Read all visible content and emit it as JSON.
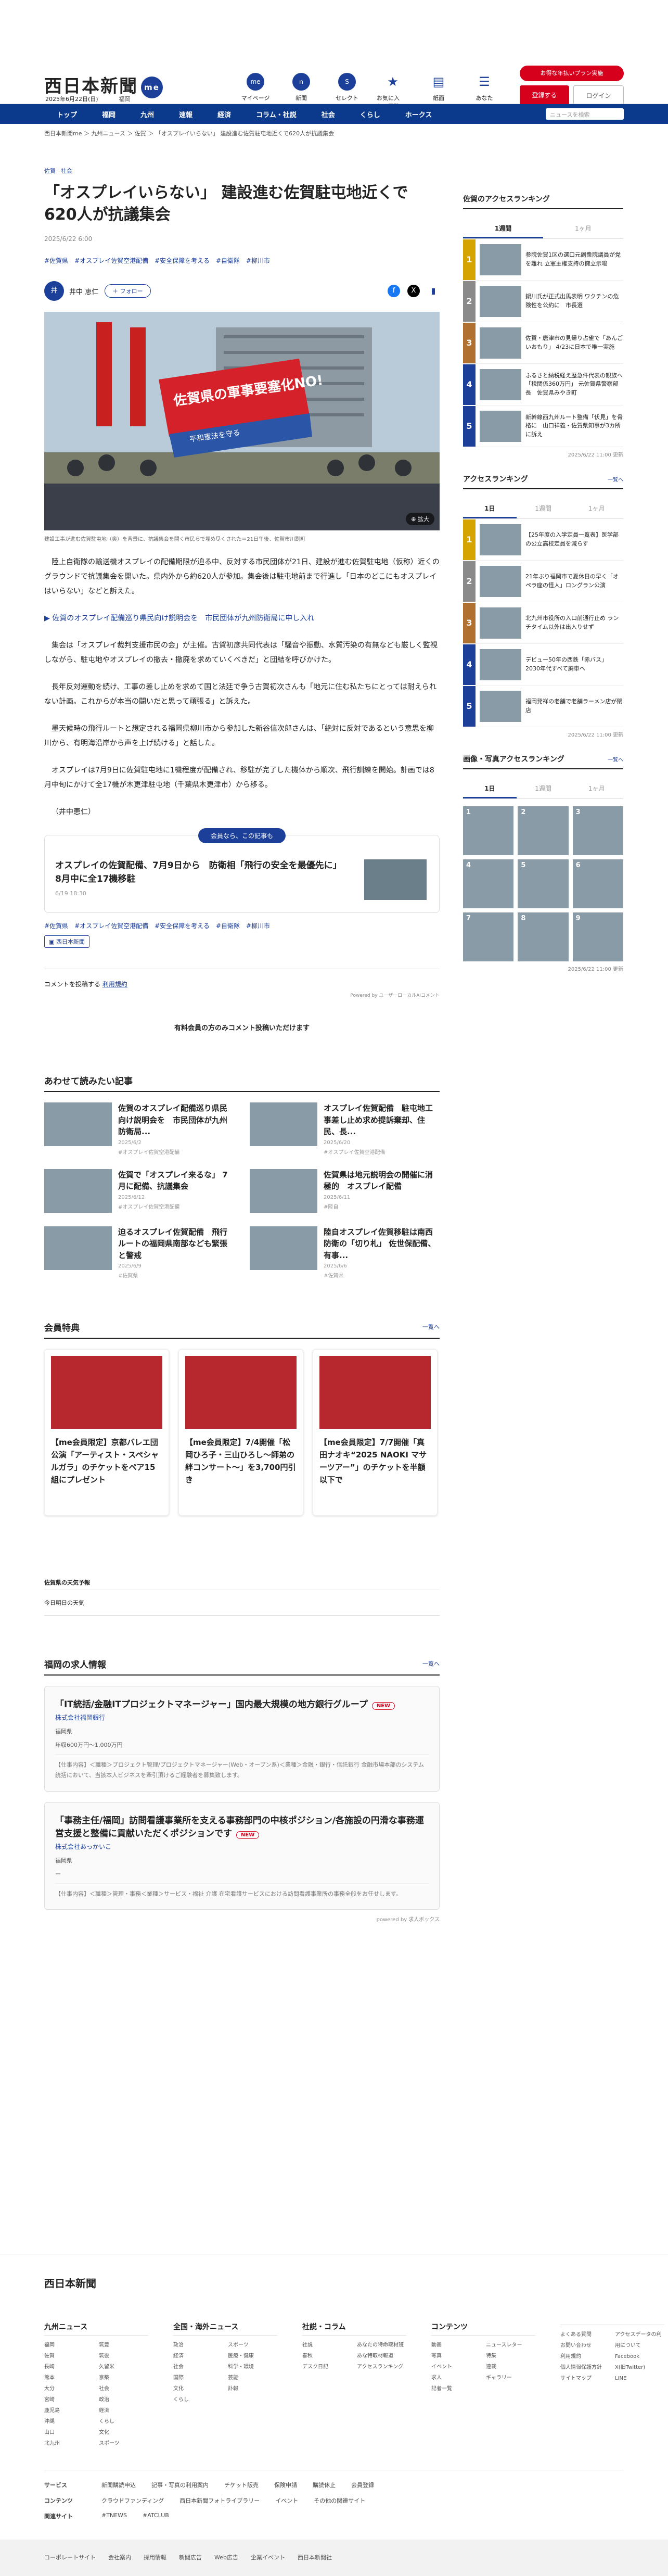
{
  "header": {
    "logo": "西日本新聞",
    "logo_badge": "me",
    "date": "2025年6月22日(日)",
    "region": "福岡",
    "icons": [
      {
        "label": "マイページ",
        "glyph": "me"
      },
      {
        "label": "新聞",
        "glyph": "ｎ"
      },
      {
        "label": "セレクト",
        "glyph": "S"
      },
      {
        "label": "お気に入り・閲覧",
        "glyph": "★"
      },
      {
        "label": "紙面",
        "glyph": "▤"
      },
      {
        "label": "あなた",
        "glyph": "☰"
      }
    ],
    "promo": "お得な年払いプラン実施",
    "register": "登録する",
    "login": "ログイン"
  },
  "nav": {
    "items": [
      "トップ",
      "福岡",
      "九州",
      "速報",
      "経済",
      "コラム・社説",
      "社会",
      "くらし",
      "ホークス"
    ],
    "search_placeholder": "ニュースを検索"
  },
  "breadcrumb": "西日本新聞me ＞ 九州ニュース ＞ 佐賀 ＞ 「オスプレイいらない」 建設進む佐賀駐屯地近くで620人が抗議集会",
  "article": {
    "categories": [
      "佐賀",
      "社会"
    ],
    "title": "「オスプレイいらない」 建設進む佐賀駐屯地近くで620人が抗議集会",
    "date": "2025/6/22 6:00",
    "keywords": [
      "#佐賀県",
      "#オスプレイ佐賀空港配備",
      "#安全保障を考える",
      "#自衛隊",
      "#柳川市"
    ],
    "author": "井中 恵仁",
    "author_initial": "井",
    "follow": "＋ フォロー",
    "photo_banner": "佐賀県の軍事要塞化NO!",
    "photo_banner_sub": "平和憲法を守る",
    "photo_zoom": "拡大",
    "caption": "建設工事が進む佐賀駐屯地（奥）を背景に、抗議集会を開く市民らで埋め尽くされた＝21日午後、佐賀市川副町",
    "paragraphs": [
      "陸上自衛隊の輸送機オスプレイの配備期限が迫る中、反対する市民団体が21日、建設が進む佐賀駐屯地（仮称）近くのグラウンドで抗議集会を開いた。県内外から約620人が参加。集会後は駐屯地前まで行進し「日本のどこにもオスプレイはいらない」などと訴えた。",
      "集会は「オスプレイ裁判支援市民の会」が主催。古賀初彦共同代表は「騒音や振動、水質汚染の有無なども厳しく監視しながら、駐屯地やオスプレイの撤去・撤廃を求めていくべきだ」と団結を呼びかけた。",
      "長年反対運動を続け、工事の差し止めを求めて国と法廷で争う古賀初次さんも「地元に住む私たちにとっては耐えられない計画。これからが本当の闘いだと思って頑張る」と訴えた。",
      "墨天候時の飛行ルートと想定される福岡県柳川市から参加した新谷信次郎さんは、「絶対に反対であるという意思を柳川から、有明海沿岸から声を上げ続ける」と話した。",
      "オスプレイは7月9日に佐賀駐屯地に1機程度が配備され、移駐が完了した機体から順次、飛行訓練を開始。計画では8月中旬にかけて全17機が木更津駐屯地（千葉県木更津市）から移る。"
    ],
    "link": "▶ 佐賀のオスプレイ配備巡り県民向け説明会を　市民団体が九州防衛局に申し入れ",
    "byline": "（井中恵仁）",
    "card": {
      "pill": "会員なら、この記事も",
      "title": "オスプレイの佐賀配備、7月9日から　防衛相「飛行の安全を最優先に」8月中に全17機移駐",
      "date": "6/19 18:30"
    },
    "feedback": "▣ 西日本新聞"
  },
  "comments": {
    "post": "コメントを投稿する",
    "rule": "利用規約",
    "powered": "Powered by ユーザーローカルAIコメント",
    "notice": "有料会員の方のみコメント投稿いただけます"
  },
  "related": {
    "title": "あわせて読みたい記事",
    "items": [
      {
        "title": "佐賀のオスプレイ配備巡り県民向け説明会を　市民団体が九州防衛局...",
        "date": "2025/6/2",
        "tag": "#オスプレイ佐賀空港配備"
      },
      {
        "title": "オスプレイ佐賀配備　駐屯地工事差し止め求め提訴棄却、住民、長...",
        "date": "2025/6/20",
        "tag": "#オスプレイ佐賀空港配備"
      },
      {
        "title": "佐賀で「オスプレイ来るな」 7月に配備、抗議集会",
        "date": "2025/6/12",
        "tag": "#オスプレイ佐賀空港配備"
      },
      {
        "title": "佐賀県は地元説明会の開催に消極的　オスプレイ配備",
        "date": "2025/6/11",
        "tag": "#陸自"
      },
      {
        "title": "迫るオスプレイ佐賀配備　飛行ルートの福岡県南部なども緊張と警戒",
        "date": "2025/6/9",
        "tag": "#佐賀県"
      },
      {
        "title": "陸自オスプレイ佐賀移駐は南西防衛の「切り札」 佐世保配備、有事...",
        "date": "2025/6/6",
        "tag": "#佐賀県"
      }
    ]
  },
  "members": {
    "title": "会員特典",
    "more": "一覧へ",
    "items": [
      {
        "title": "【me会員限定】京都バレエ団公演「アーティスト・スペシャルガラ」のチケットをペア15組にプレゼント"
      },
      {
        "title": "【me会員限定】7/4開催「松岡ひろ子・三山ひろし～師弟の絆コンサート～」を3,700円引き"
      },
      {
        "title": "【me会員限定】7/7開催「真田ナオキ“2025 NAOKI マサーツアー”」のチケットを半額以下で"
      }
    ]
  },
  "weather": {
    "title": "佐賀県の天気予報",
    "body": "今日明日の天気"
  },
  "jobs": {
    "title": "福岡の求人情報",
    "more": "一覧へ",
    "items": [
      {
        "title": "「IT統括/金融ITプロジェクトマネージャー」国内最大規模の地方銀行グループ",
        "badge": "NEW",
        "company": "株式会社福岡銀行",
        "location": "福岡県",
        "salary": "年収600万円〜1,000万円",
        "desc": "【仕事内容】＜職種＞プロジェクト管理/プロジェクトマネージャー(Web・オープン系)＜業種＞金融・銀行・信託銀行 金融市場本部のシステム統括において、当該本人ビジネスを牽引頂けるご経験者を募集致します。"
      },
      {
        "title": "「事務主任/福岡」訪問看護事業所を支える事務部門の中核ポジション/各施設の円滑な事務運営支援と整備に貢献いただくポジションです",
        "badge": "NEW",
        "company": "株式会社あっかいこ",
        "location": "福岡県",
        "salary": "ー",
        "desc": "【仕事内容】＜職種＞管理・事務＜業種＞サービス・福祉 介護 在宅看護サービスにおける訪問看護事業所の事務全般をお任せします。"
      }
    ],
    "powered": "powered by 求人ボックス"
  },
  "side": {
    "access_title": "佐賀のアクセスランキング",
    "tabs": [
      "1週間",
      "1ヶ月"
    ],
    "access": [
      "参院佐賀1区の選口元副衆院議員が党を離れ 立憲主権支持の擁立示唆",
      "鍋川氏が正式出馬表明 ワクチンの危険性を公約に　市長選",
      "佐賀・唐津市の見帰り占雀で「あんごいおもり」 4/23に日本で唯一実施",
      "ふるさと納税経え歴急件代表の親族へ「税関係360万円」 元佐賀県警察部長　佐賀県みやき町",
      "新幹線西九州ルート整備「伏見」を骨格に　山口祥義・佐賀県知事が3カ所に訴え"
    ],
    "updated": "2025/6/22 11:00 更新",
    "overall_title": "アクセスランキング",
    "overall_more": "一覧へ",
    "overall_tabs": [
      "1日",
      "1週間",
      "1ヶ月"
    ],
    "overall": [
      "【25年度の入学定員一覧表】医学部の公立高校定員を減らす",
      "21年ぶり福岡市で夏休日の早く「オペラ座の怪人」ロングラン公演",
      "北九州市役所の入口前通行止め ランチタイム以外は出入りせず",
      "デビュー50年の西鉄「赤バス」 2030年代すべて廃車へ",
      "福岡発祥の老舗で老舗ラーメン店が閉店"
    ],
    "updated2": "2025/6/22 11:00 更新",
    "photo_title": "画像・写真アクセスランキング",
    "photo_more": "一覧へ",
    "photo_tabs": [
      "1日",
      "1週間",
      "1ヶ月"
    ],
    "photo_nums": [
      "1",
      "2",
      "3",
      "4",
      "5",
      "6",
      "7",
      "8",
      "9"
    ],
    "updated3": "2025/6/22 11:00 更新"
  },
  "footer": {
    "logo": "西日本新聞",
    "cols": [
      {
        "title": "九州ニュース",
        "items": [
          "福岡",
          "佐賀",
          "長崎",
          "熊本",
          "大分",
          "宮崎",
          "鹿児島",
          "沖縄",
          "山口",
          "北九州",
          "筑豊",
          "筑後",
          "久留米",
          "京築",
          "社会",
          "政治",
          "経済",
          "くらし",
          "文化",
          "スポーツ"
        ]
      },
      {
        "title": "全国・海外ニュース",
        "items": [
          "政治",
          "経済",
          "社会",
          "国際",
          "文化",
          "くらし",
          "スポーツ",
          "医療・健康",
          "科学・環境",
          "芸能",
          "訃報"
        ]
      },
      {
        "title": "社説・コラム",
        "items": [
          "社説",
          "春秋",
          "デスク日記",
          "あなたの特命取材班",
          "あな特取材報道",
          "アクセスランキング"
        ]
      },
      {
        "title": "コンテンツ",
        "items": [
          "動画",
          "写真",
          "イベント",
          "求人",
          "記者一覧",
          "ニュースレター",
          "特集",
          "連載",
          "ギャラリー"
        ]
      },
      {
        "title": "",
        "items": [
          "よくある質問",
          "お問い合わせ",
          "利用規約",
          "個人情報保護方針",
          "サイトマップ",
          "アクセスデータの利用について",
          "Facebook",
          "X(旧Twitter)",
          "LINE"
        ]
      }
    ],
    "rows": [
      {
        "label": "サービス",
        "items": [
          "新聞購読申込",
          "記事・写真の利用案内",
          "チケット販売",
          "保険申請",
          "購読休止",
          "会員登録"
        ]
      },
      {
        "label": "コンテンツ",
        "items": [
          "クラウドファンディング",
          "西日本新聞フォトライブラリー",
          "イベント",
          "その他の関連サイト"
        ]
      },
      {
        "label": "関連サイト",
        "items": [
          "#TNEWS",
          "#ATCLUB"
        ]
      }
    ],
    "copyright": [
      "コーポレートサイト",
      "会社案内",
      "採用情報",
      "新聞広告",
      "Web広告",
      "企業イベント",
      "西日本新聞社"
    ]
  }
}
